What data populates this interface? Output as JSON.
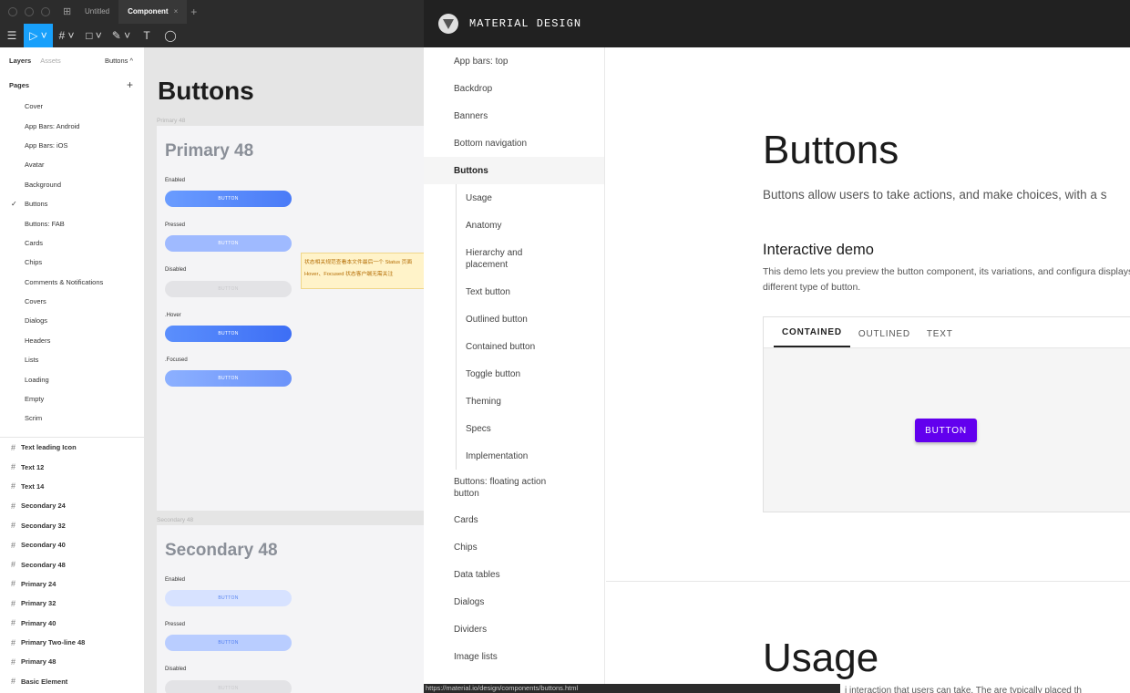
{
  "figma": {
    "tabs": {
      "untitled": "Untitled",
      "component": "Component",
      "close": "×",
      "add": "+"
    },
    "toolbar": {
      "menu": "☰",
      "move": "▷ ˅",
      "frame": "# ˅",
      "shape": "□ ˅",
      "pen": "✎ ˅",
      "text": "T",
      "comment": "◯"
    },
    "layers": {
      "tab_layers": "Layers",
      "tab_assets": "Assets",
      "page_selector": "Buttons ^"
    },
    "pages": {
      "heading": "Pages",
      "add": "+",
      "items": [
        "Cover",
        "App Bars: Android",
        "App Bars: iOS",
        "Avatar",
        "Background",
        "Buttons",
        "Buttons: FAB",
        "Cards",
        "Chips",
        "Comments & Notifications",
        "Covers",
        "Dialogs",
        "Headers",
        "Lists",
        "Loading",
        "Empty",
        "Scrim"
      ],
      "active_check": "✓"
    },
    "frames": [
      "Text leading Icon",
      "Text 12",
      "Text 14",
      "Secondary 24",
      "Secondary 32",
      "Secondary 40",
      "Secondary 48",
      "Primary 24",
      "Primary 32",
      "Primary 40",
      "Primary Two-line 48",
      "Primary 48",
      "Basic Element"
    ],
    "canvas": {
      "title": "Buttons",
      "primary_frame_label": "Primary 48",
      "primary_title": "Primary 48",
      "states": [
        "Enabled",
        "Pressed",
        "Disabled",
        ".Hover",
        ".Focused"
      ],
      "button_label": "BUTTON",
      "secondary_frame_label": "Secondary 48",
      "secondary_title": "Secondary 48",
      "secondary_states": [
        "Enabled",
        "Pressed",
        "Disabled"
      ],
      "note_line1": "状态相关规范查看本文件最后一个 Status 页面",
      "note_line2": "Hover、Focused 状态客户端无需关注"
    }
  },
  "browser": {
    "brand": "MATERIAL DESIGN",
    "nav": {
      "before": [
        "App bars: top",
        "Backdrop",
        "Banners",
        "Bottom navigation"
      ],
      "active": "Buttons",
      "sub": [
        "Usage",
        "Anatomy",
        "Hierarchy and placement",
        "Text button",
        "Outlined button",
        "Contained button",
        "Toggle button",
        "Theming",
        "Specs",
        "Implementation"
      ],
      "after": [
        "Buttons: floating action button",
        "Cards",
        "Chips",
        "Data tables",
        "Dialogs",
        "Dividers",
        "Image lists"
      ]
    },
    "content": {
      "title": "Buttons",
      "lead": "Buttons allow users to take actions, and make choices, with a s",
      "demo_title": "Interactive demo",
      "demo_desc": "This demo lets you preview the button component, its variations, and configura displays a different type of button.",
      "demo_tabs": [
        "CONTAINED",
        "OUTLINED",
        "TEXT"
      ],
      "demo_button": "BUTTON",
      "usage_title": "Usage",
      "usage_fragment": "i  interaction that users can take. The are typically placed th"
    },
    "status_url": "https://material.io/design/components/buttons.html",
    "colors": {
      "demo_button": "#6200ee",
      "appbar": "#212121",
      "figma_selection": "#18a0fb"
    }
  }
}
